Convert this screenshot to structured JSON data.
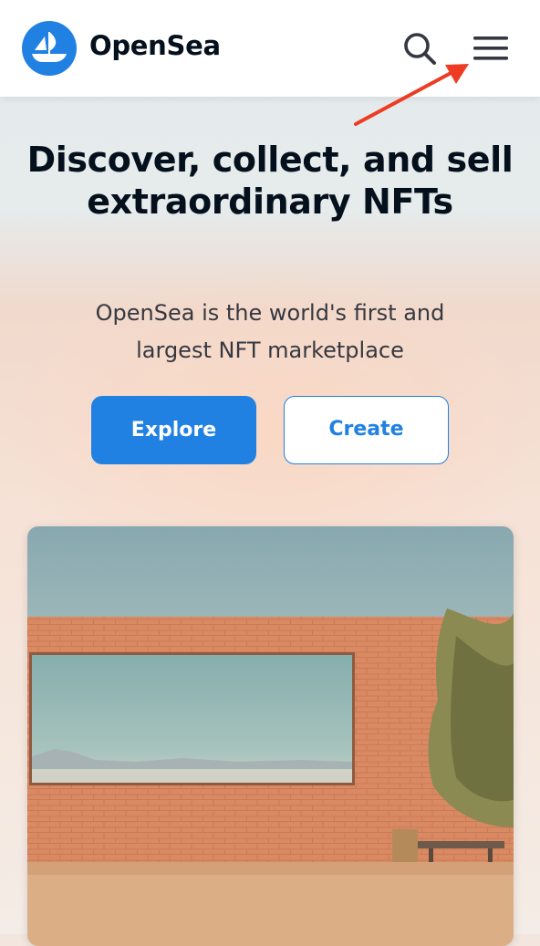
{
  "header": {
    "brand": "OpenSea",
    "search_icon": "search-icon",
    "menu_icon": "menu-icon"
  },
  "hero": {
    "headline": "Discover, collect, and sell extraordinary NFTs",
    "subtitle": "OpenSea is the world's first and largest NFT marketplace",
    "explore_label": "Explore",
    "create_label": "Create"
  },
  "colors": {
    "accent": "#2081e2",
    "text_dark": "#04111d",
    "annotation_arrow": "#ee3b24"
  }
}
